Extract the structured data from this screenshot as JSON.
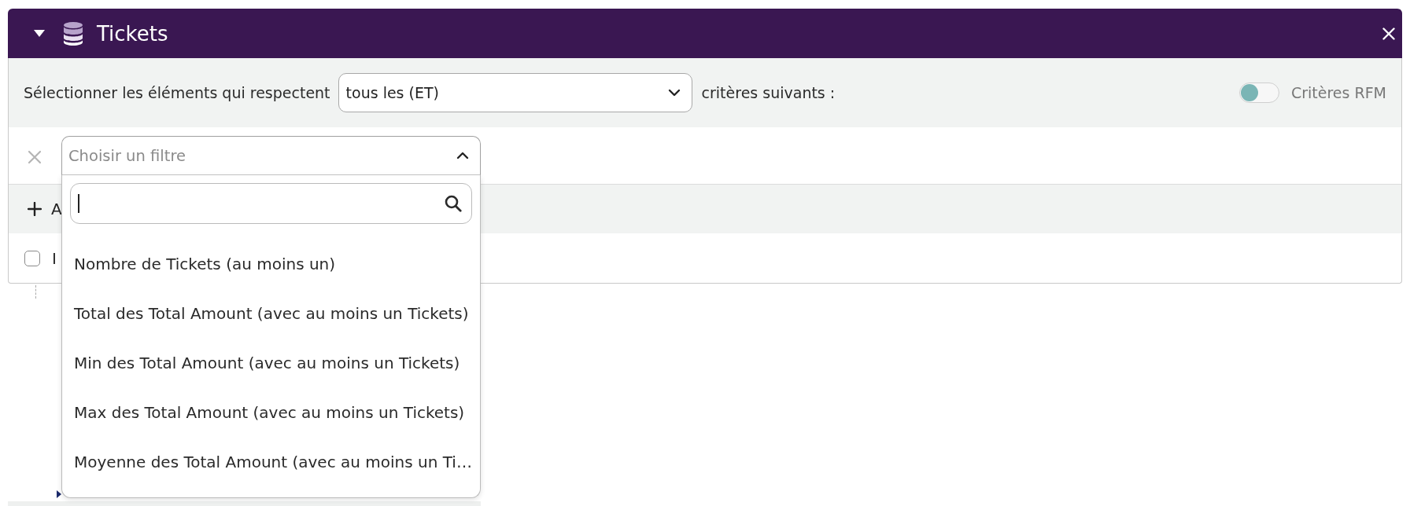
{
  "panel": {
    "title": "Tickets",
    "expanded": true
  },
  "criteria": {
    "label": "Sélectionner les éléments qui respectent",
    "mode": "tous les (ET)",
    "suffix": "critères suivants :",
    "rfm_toggle": {
      "label": "Critères RFM",
      "on": false
    }
  },
  "filter": {
    "placeholder": "Choisir un filtre",
    "open": true,
    "search_field": {
      "focused": true
    },
    "options": [
      {
        "label": "Nombre de Tickets (au moins un)",
        "selected": false
      },
      {
        "label": "Total des Total Amount (avec au moins un Tickets)",
        "selected": false
      },
      {
        "label": "Min des Total Amount (avec au moins un Tickets)",
        "selected": false
      },
      {
        "label": "Max des Total Amount (avec au moins un Tickets)",
        "selected": false
      },
      {
        "label": "Moyenne des Total Amount (avec au moins un Ti…",
        "selected": false
      }
    ]
  },
  "add_row": {
    "label": "A"
  },
  "checkbox_row": {
    "label": "I",
    "checked": false
  }
}
